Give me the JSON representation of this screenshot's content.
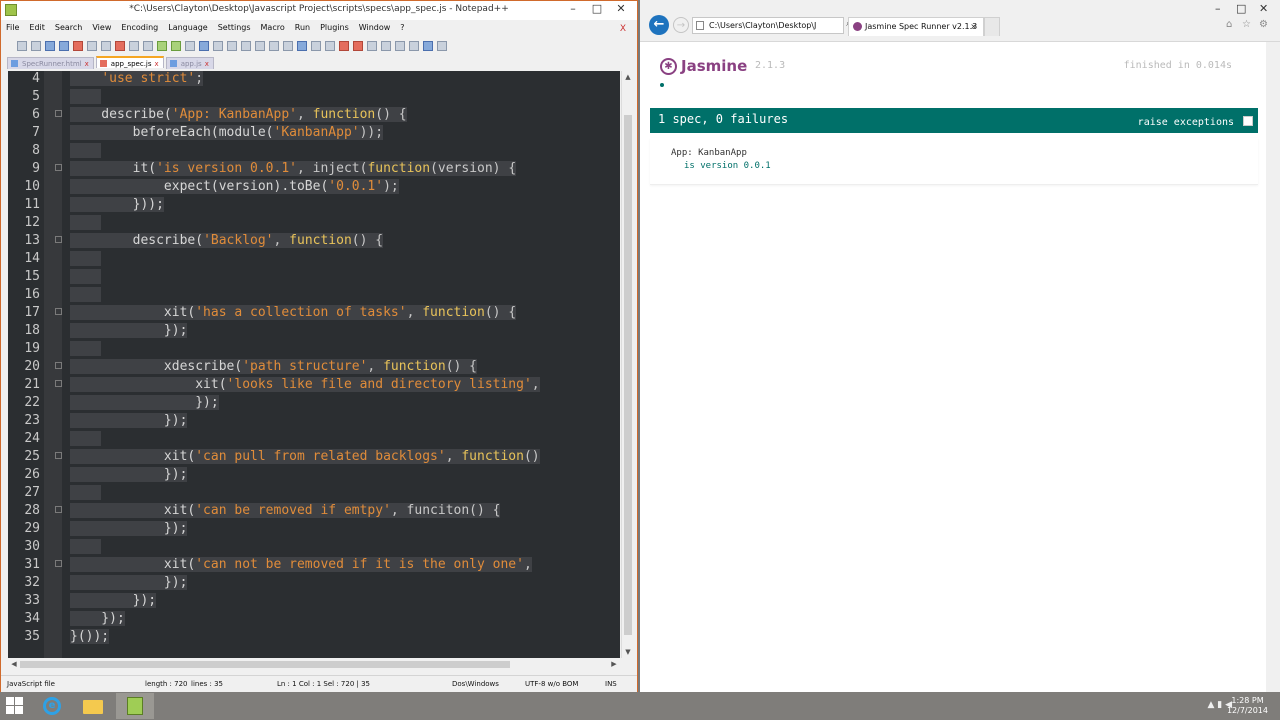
{
  "notepad": {
    "title": "*C:\\Users\\Clayton\\Desktop\\Javascript Project\\scripts\\specs\\app_spec.js - Notepad++",
    "menu": [
      "File",
      "Edit",
      "Search",
      "View",
      "Encoding",
      "Language",
      "Settings",
      "Macro",
      "Run",
      "Plugins",
      "Window",
      "?"
    ],
    "menu_close": "X",
    "tabs": [
      {
        "label": "SpecRunner.html",
        "close": "x"
      },
      {
        "label": "app_spec.js",
        "close": "x"
      },
      {
        "label": "app.js",
        "close": "x"
      }
    ],
    "status": {
      "file_type": "JavaScript file",
      "length": "length : 720",
      "lines": "lines : 35",
      "position": "Ln : 1    Col : 1    Sel : 720 | 35",
      "eol": "Dos\\Windows",
      "encoding": "UTF-8 w/o BOM",
      "mode": "INS"
    },
    "window_buttons": {
      "minimize": "–",
      "maximize": "□",
      "close": "✕"
    },
    "code": [
      {
        "n": "4",
        "fold": false,
        "parts": [
          [
            "t",
            "    "
          ],
          [
            "s",
            "'use strict'"
          ],
          [
            "p",
            ";"
          ]
        ]
      },
      {
        "n": "5",
        "fold": false,
        "parts": []
      },
      {
        "n": "6",
        "fold": true,
        "parts": [
          [
            "t",
            "    describe("
          ],
          [
            "s",
            "'App: KanbanApp'"
          ],
          [
            "p",
            ", "
          ],
          [
            "k",
            "function"
          ],
          [
            "p",
            "() {"
          ]
        ]
      },
      {
        "n": "7",
        "fold": false,
        "parts": [
          [
            "t",
            "        beforeEach(module("
          ],
          [
            "s",
            "'KanbanApp'"
          ],
          [
            "p",
            "));"
          ]
        ]
      },
      {
        "n": "8",
        "fold": false,
        "parts": []
      },
      {
        "n": "9",
        "fold": true,
        "parts": [
          [
            "t",
            "        it("
          ],
          [
            "s",
            "'is version 0.0.1'"
          ],
          [
            "p",
            ", inject("
          ],
          [
            "k",
            "function"
          ],
          [
            "p",
            "(version) {"
          ]
        ]
      },
      {
        "n": "10",
        "fold": false,
        "parts": [
          [
            "t",
            "            expect(version).toBe("
          ],
          [
            "s",
            "'0.0.1'"
          ],
          [
            "p",
            ");"
          ]
        ]
      },
      {
        "n": "11",
        "fold": false,
        "parts": [
          [
            "t",
            "        }));"
          ]
        ]
      },
      {
        "n": "12",
        "fold": false,
        "parts": []
      },
      {
        "n": "13",
        "fold": true,
        "parts": [
          [
            "t",
            "        describe("
          ],
          [
            "s",
            "'Backlog'"
          ],
          [
            "p",
            ", "
          ],
          [
            "k",
            "function"
          ],
          [
            "p",
            "() {"
          ]
        ]
      },
      {
        "n": "14",
        "fold": false,
        "parts": []
      },
      {
        "n": "15",
        "fold": false,
        "parts": []
      },
      {
        "n": "16",
        "fold": false,
        "parts": []
      },
      {
        "n": "17",
        "fold": true,
        "parts": [
          [
            "t",
            "            xit("
          ],
          [
            "s",
            "'has a collection of tasks'"
          ],
          [
            "p",
            ", "
          ],
          [
            "k",
            "function"
          ],
          [
            "p",
            "() {"
          ]
        ]
      },
      {
        "n": "18",
        "fold": false,
        "parts": [
          [
            "t",
            "            });"
          ]
        ]
      },
      {
        "n": "19",
        "fold": false,
        "parts": []
      },
      {
        "n": "20",
        "fold": true,
        "parts": [
          [
            "t",
            "            xdescribe("
          ],
          [
            "s",
            "'path structure'"
          ],
          [
            "p",
            ", "
          ],
          [
            "k",
            "function"
          ],
          [
            "p",
            "() {"
          ]
        ]
      },
      {
        "n": "21",
        "fold": true,
        "parts": [
          [
            "t",
            "                xit("
          ],
          [
            "s",
            "'looks like file and directory listing'"
          ],
          [
            "p",
            ","
          ]
        ]
      },
      {
        "n": "22",
        "fold": false,
        "parts": [
          [
            "t",
            "                });"
          ]
        ]
      },
      {
        "n": "23",
        "fold": false,
        "parts": [
          [
            "t",
            "            });"
          ]
        ]
      },
      {
        "n": "24",
        "fold": false,
        "parts": []
      },
      {
        "n": "25",
        "fold": true,
        "parts": [
          [
            "t",
            "            xit("
          ],
          [
            "s",
            "'can pull from related backlogs'"
          ],
          [
            "p",
            ", "
          ],
          [
            "k",
            "function"
          ],
          [
            "p",
            "()"
          ]
        ]
      },
      {
        "n": "26",
        "fold": false,
        "parts": [
          [
            "t",
            "            });"
          ]
        ]
      },
      {
        "n": "27",
        "fold": false,
        "parts": []
      },
      {
        "n": "28",
        "fold": true,
        "parts": [
          [
            "t",
            "            xit("
          ],
          [
            "s",
            "'can be removed if emtpy'"
          ],
          [
            "p",
            ", funciton() {"
          ]
        ]
      },
      {
        "n": "29",
        "fold": false,
        "parts": [
          [
            "t",
            "            });"
          ]
        ]
      },
      {
        "n": "30",
        "fold": false,
        "parts": []
      },
      {
        "n": "31",
        "fold": true,
        "parts": [
          [
            "t",
            "            xit("
          ],
          [
            "s",
            "'can not be removed if it is the only one'"
          ],
          [
            "p",
            ","
          ]
        ]
      },
      {
        "n": "32",
        "fold": false,
        "parts": [
          [
            "t",
            "            });"
          ]
        ]
      },
      {
        "n": "33",
        "fold": false,
        "parts": [
          [
            "t",
            "        });"
          ]
        ]
      },
      {
        "n": "34",
        "fold": false,
        "parts": [
          [
            "t",
            "    });"
          ]
        ]
      },
      {
        "n": "35",
        "fold": false,
        "parts": [
          [
            "t",
            "}());"
          ]
        ]
      }
    ]
  },
  "browser": {
    "address": "C:\\Users\\Clayton\\Desktop\\J",
    "tab_title": "Jasmine Spec Runner v2.1.3",
    "tab_close": "×",
    "window_buttons": {
      "minimize": "–",
      "maximize": "□",
      "close": "✕"
    }
  },
  "jasmine": {
    "brand": "Jasmine",
    "version": "2.1.3",
    "duration": "finished in 0.014s",
    "summary": "1 spec, 0 failures",
    "raise_exceptions": "raise exceptions",
    "suite": "App: KanbanApp",
    "spec": "is version 0.0.1",
    "accent": "#8a4182",
    "pass_color": "#007069"
  },
  "taskbar": {
    "time": "1:28 PM",
    "date": "12/7/2014"
  }
}
